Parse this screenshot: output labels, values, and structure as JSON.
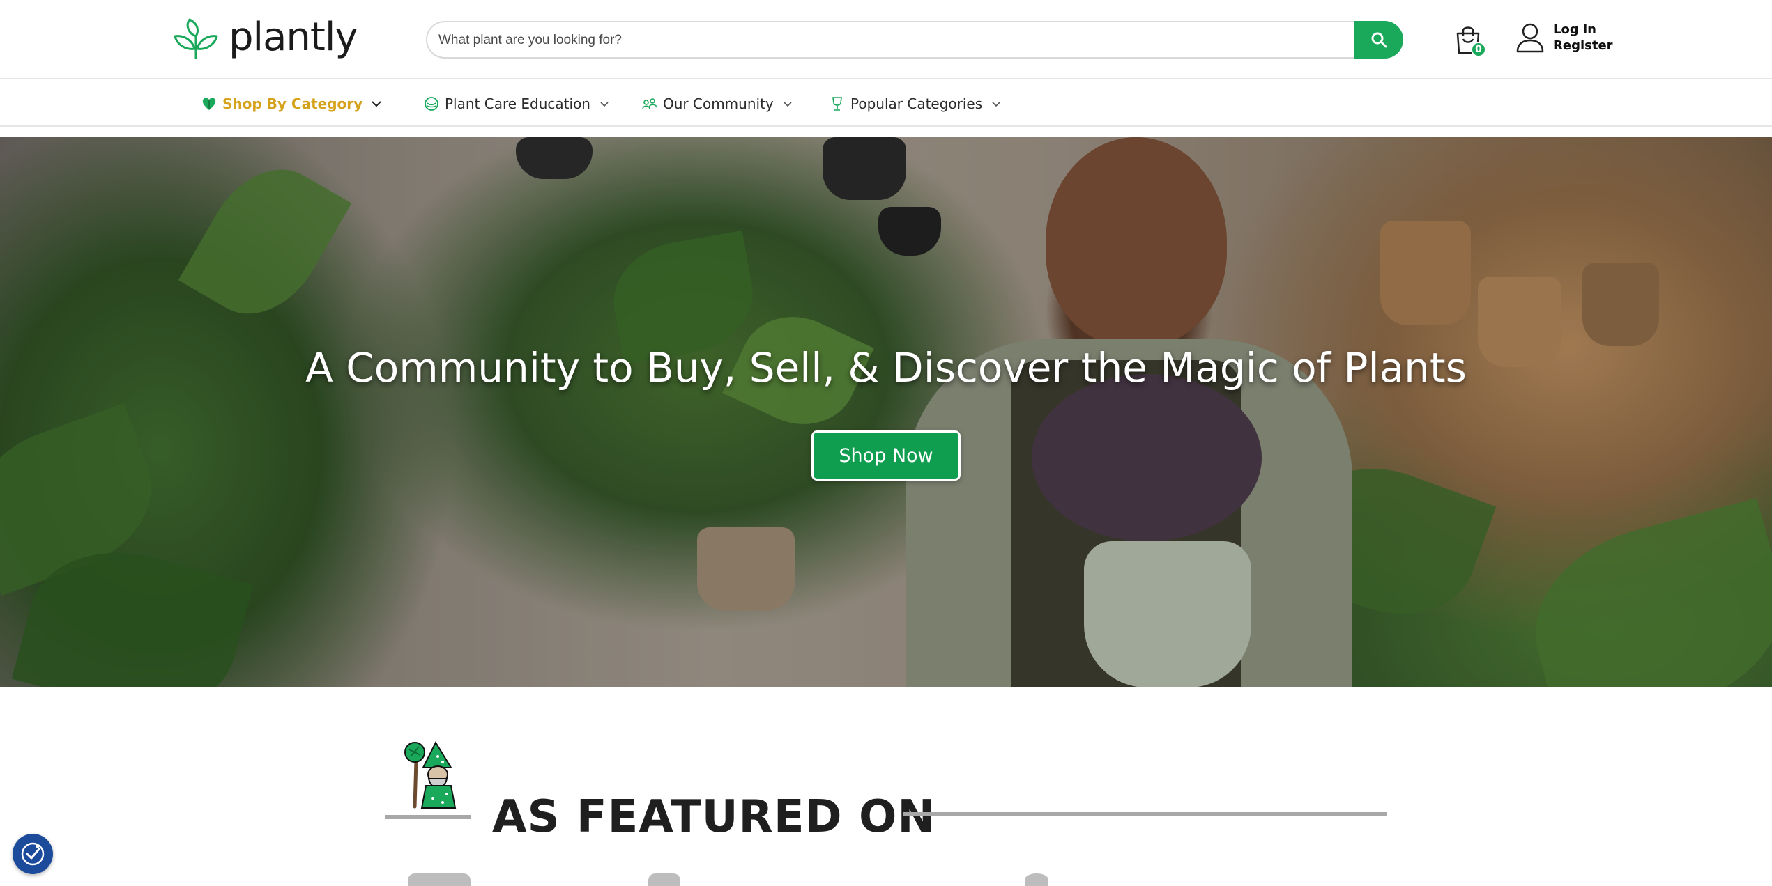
{
  "header": {
    "logo_text": "plantly",
    "search_placeholder": "What plant are you looking for?",
    "cart_count": "0",
    "login_label": "Log in",
    "register_label": "Register"
  },
  "nav": {
    "items": [
      {
        "label": "Shop By Category",
        "icon": "heart-leaf-icon",
        "active": true
      },
      {
        "label": "Plant Care Education",
        "icon": "globe-leaf-icon",
        "active": false
      },
      {
        "label": "Our Community",
        "icon": "community-icon",
        "active": false
      },
      {
        "label": "Popular Categories",
        "icon": "trophy-icon",
        "active": false
      }
    ]
  },
  "hero": {
    "title": "A Community to Buy, Sell, & Discover the Magic of Plants",
    "button_label": "Shop Now"
  },
  "featured": {
    "title": "AS FEATURED ON"
  },
  "colors": {
    "brand_green": "#1aa85a",
    "active_nav": "#d5a21c",
    "a11y_blue": "#1c4b9c"
  }
}
